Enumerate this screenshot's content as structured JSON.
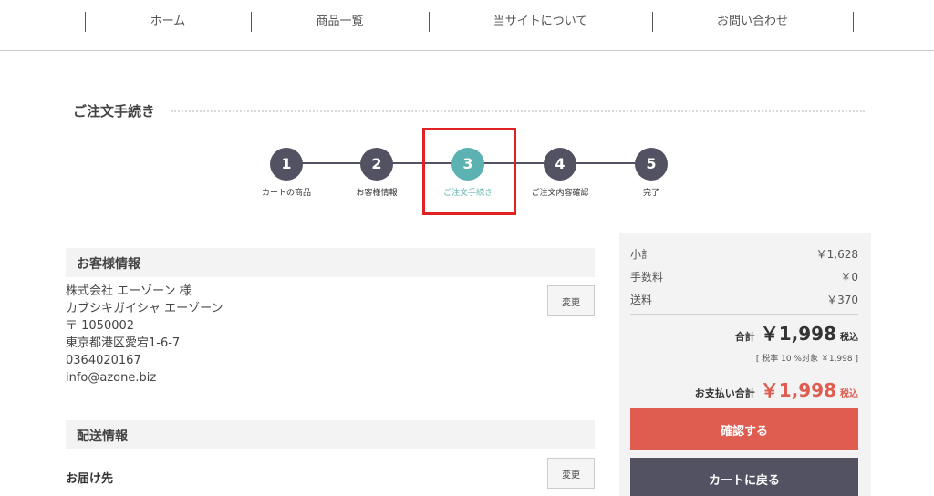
{
  "nav": {
    "items": [
      {
        "label": "ホーム"
      },
      {
        "label": "商品一覧"
      },
      {
        "label": "当サイトについて"
      },
      {
        "label": "お問い合わせ"
      }
    ]
  },
  "page": {
    "title": "ご注文手続き"
  },
  "steps": [
    {
      "number": "1",
      "label": "カートの商品"
    },
    {
      "number": "2",
      "label": "お客様情報"
    },
    {
      "number": "3",
      "label": "ご注文手続き"
    },
    {
      "number": "4",
      "label": "ご注文内容確認"
    },
    {
      "number": "5",
      "label": "完了"
    }
  ],
  "customer": {
    "section_title": "お客様情報",
    "change_label": "変更",
    "lines": [
      "株式会社 エーゾーン 様",
      "カブシキガイシャ エーゾーン",
      "〒 1050002",
      "東京都港区愛宕1-6-7",
      "0364020167",
      "info@azone.biz"
    ]
  },
  "delivery": {
    "section_title": "配送情報",
    "destination_label": "お届け先",
    "change_label": "変更"
  },
  "summary": {
    "subtotal_label": "小計",
    "subtotal_value": "￥1,628",
    "fee_label": "手数料",
    "fee_value": "￥0",
    "shipping_label": "送料",
    "shipping_value": "￥370",
    "total_label": "合計",
    "total_value": "￥1,998",
    "tax_incl": "税込",
    "tax_note": "[ 税率 10 %対象 ￥1,998 ]",
    "payment_label": "お支払い合計",
    "payment_value": "￥1,998",
    "confirm_button": "確認する",
    "back_button": "カートに戻る"
  },
  "colors": {
    "accent_red": "#de5d50",
    "step_active": "#5cb1b1",
    "dark": "#525263",
    "highlight": "#e02222"
  }
}
